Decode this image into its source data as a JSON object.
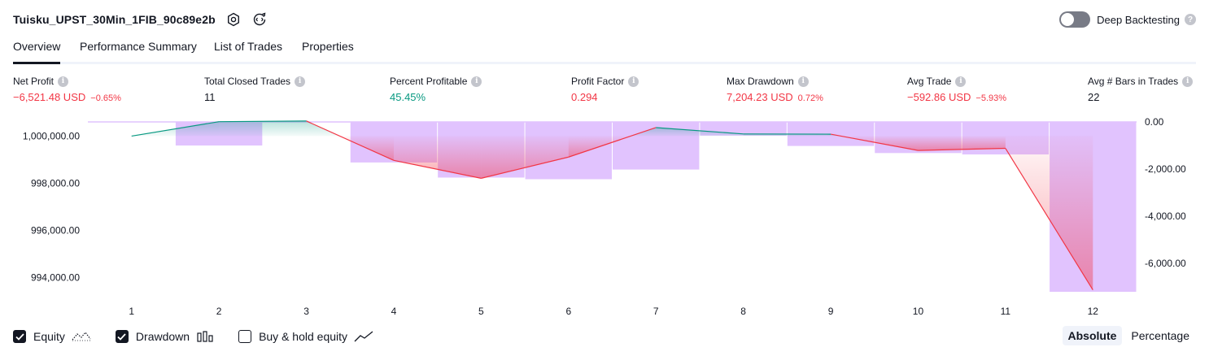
{
  "header": {
    "title": "Tuisku_UPST_30Min_1FIB_90c89e2b"
  },
  "deep_backtesting": {
    "label": "Deep Backtesting",
    "help": "?"
  },
  "tabs": [
    {
      "label": "Overview",
      "active": true
    },
    {
      "label": "Performance Summary",
      "active": false
    },
    {
      "label": "List of Trades",
      "active": false
    },
    {
      "label": "Properties",
      "active": false
    }
  ],
  "metrics": [
    {
      "label": "Net Profit",
      "value": "−6,521.48 USD",
      "pct": "−0.65%",
      "color": "neg"
    },
    {
      "label": "Total Closed Trades",
      "value": "11",
      "pct": "",
      "color": "plain"
    },
    {
      "label": "Percent Profitable",
      "value": "45.45%",
      "pct": "",
      "color": "pos"
    },
    {
      "label": "Profit Factor",
      "value": "0.294",
      "pct": "",
      "color": "neg"
    },
    {
      "label": "Max Drawdown",
      "value": "7,204.23 USD",
      "pct": "0.72%",
      "color": "neg"
    },
    {
      "label": "Avg Trade",
      "value": "−592.86 USD",
      "pct": "−5.93%",
      "color": "neg"
    },
    {
      "label": "Avg # Bars in Trades",
      "value": "22",
      "pct": "",
      "color": "plain"
    }
  ],
  "info_glyph": "i",
  "chart_data": {
    "type": "line",
    "x": [
      1,
      2,
      3,
      4,
      5,
      6,
      7,
      8,
      9,
      10,
      11,
      12
    ],
    "x_tick_labels": [
      "1",
      "2",
      "3",
      "4",
      "5",
      "6",
      "7",
      "8",
      "9",
      "10",
      "11",
      "12"
    ],
    "series": [
      {
        "name": "Equity",
        "type": "line",
        "values": [
          1000000,
          1000610,
          1000640,
          998970,
          998210,
          999110,
          1000360,
          1000090,
          1000080,
          999390,
          999480,
          993480
        ]
      },
      {
        "name": "Drawdown",
        "type": "bar",
        "values": [
          0,
          -1000,
          -20,
          -1720,
          -2360,
          -2430,
          -2020,
          -580,
          -1020,
          -1320,
          -1380,
          -7204.23
        ]
      }
    ],
    "left_axis": {
      "ylim": [
        993400,
        1000600
      ],
      "ticks": [
        1000000,
        998000,
        996000,
        994000
      ],
      "tick_labels": [
        "1,000,000.00",
        "998,000.00",
        "996,000.00",
        "994,000.00"
      ]
    },
    "right_axis": {
      "ylim": [
        -7204.23,
        0
      ],
      "ticks": [
        0,
        -2000,
        -4000,
        -6000
      ],
      "tick_labels": [
        "0.00",
        "-2,000.00",
        "-4,000.00",
        "-6,000.00"
      ]
    },
    "colors": {
      "equity_up": "#089981",
      "equity_down": "#f23645",
      "drawdown_bar": "#e1c3fe",
      "axis_text": "#131722"
    },
    "grid": false
  },
  "legend": [
    {
      "label": "Equity",
      "checked": true,
      "icon": "equity-line-icon"
    },
    {
      "label": "Drawdown",
      "checked": true,
      "icon": "drawdown-bars-icon"
    },
    {
      "label": "Buy & hold equity",
      "checked": false,
      "icon": "buy-hold-line-icon"
    }
  ],
  "mode": {
    "absolute": "Absolute",
    "percentage": "Percentage",
    "selected": "Absolute"
  }
}
